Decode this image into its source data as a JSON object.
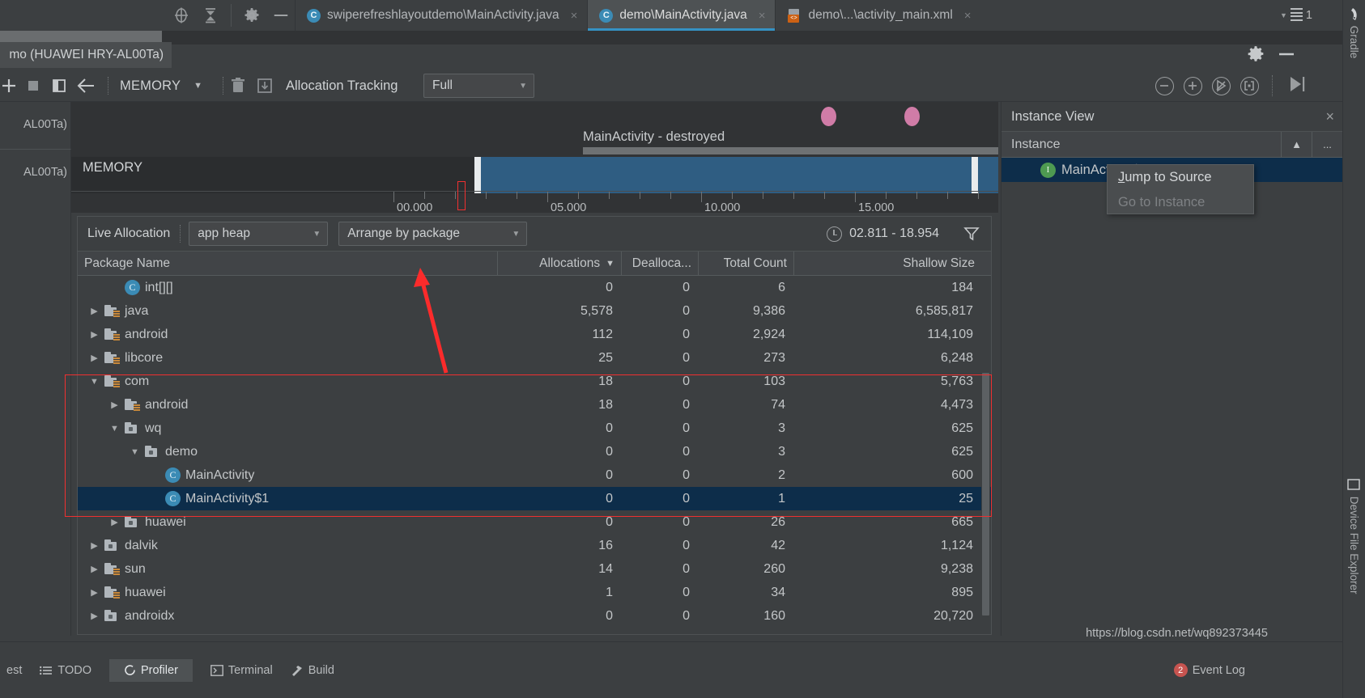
{
  "window": {
    "tabs": [
      {
        "label": "swiperefreshlayoutdemo\\MainActivity.java",
        "icon": "java-class-icon",
        "active": false,
        "close": "×"
      },
      {
        "label": "demo\\MainActivity.java",
        "icon": "java-class-icon",
        "active": true,
        "close": "×"
      },
      {
        "label": "demo\\...\\activity_main.xml",
        "icon": "xml-file-icon",
        "active": false,
        "close": "×"
      }
    ],
    "notification_count": "1"
  },
  "right_strip": {
    "gradle_label": "Gradle",
    "device_file_explorer_label": "Device File Explorer"
  },
  "profiler": {
    "device_label": "mo (HUAWEI HRY-AL00Ta)",
    "left_stub_1": "AL00Ta)",
    "left_stub_2": "AL00Ta)",
    "toolbar": {
      "session_label": "MEMORY",
      "allocation_tracking_label": "Allocation Tracking",
      "allocation_tracking_value": "Full"
    }
  },
  "timeline": {
    "activity_label": "MainActivity - destroyed",
    "memory_label": "MEMORY",
    "ticks": [
      "00.000",
      "05.000",
      "10.000",
      "15.000"
    ]
  },
  "allocation_bar": {
    "title": "Live Allocation",
    "heap_value": "app heap",
    "arrange_value": "Arrange by package",
    "time_range": "02.811 - 18.954"
  },
  "table": {
    "columns": [
      {
        "label": "Package Name",
        "align": "left"
      },
      {
        "label": "Allocations",
        "align": "right",
        "sorted": true,
        "sort_caret": "▼"
      },
      {
        "label": "Dealloca...",
        "align": "right"
      },
      {
        "label": "Total Count",
        "align": "right"
      },
      {
        "label": "Shallow Size",
        "align": "right"
      }
    ],
    "rows": [
      {
        "name": "int[][]",
        "icon": "class-icon",
        "indent": 1,
        "expander": "",
        "allocations": "0",
        "deallocations": "0",
        "total_count": "6",
        "shallow_size": "184",
        "selected": false
      },
      {
        "name": "java",
        "icon": "java-package-icon",
        "indent": 0,
        "expander": "▶",
        "allocations": "5,578",
        "deallocations": "0",
        "total_count": "9,386",
        "shallow_size": "6,585,817",
        "selected": false
      },
      {
        "name": "android",
        "icon": "java-package-icon",
        "indent": 0,
        "expander": "▶",
        "allocations": "112",
        "deallocations": "0",
        "total_count": "2,924",
        "shallow_size": "114,109",
        "selected": false
      },
      {
        "name": "libcore",
        "icon": "java-package-icon",
        "indent": 0,
        "expander": "▶",
        "allocations": "25",
        "deallocations": "0",
        "total_count": "273",
        "shallow_size": "6,248",
        "selected": false
      },
      {
        "name": "com",
        "icon": "java-package-icon",
        "indent": 0,
        "expander": "▼",
        "allocations": "18",
        "deallocations": "0",
        "total_count": "103",
        "shallow_size": "5,763",
        "selected": false
      },
      {
        "name": "android",
        "icon": "java-package-icon",
        "indent": 1,
        "expander": "▶",
        "allocations": "18",
        "deallocations": "0",
        "total_count": "74",
        "shallow_size": "4,473",
        "selected": false
      },
      {
        "name": "wq",
        "icon": "package-icon",
        "indent": 1,
        "expander": "▼",
        "allocations": "0",
        "deallocations": "0",
        "total_count": "3",
        "shallow_size": "625",
        "selected": false
      },
      {
        "name": "demo",
        "icon": "package-icon",
        "indent": 2,
        "expander": "▼",
        "allocations": "0",
        "deallocations": "0",
        "total_count": "3",
        "shallow_size": "625",
        "selected": false
      },
      {
        "name": "MainActivity",
        "icon": "class-icon",
        "indent": 3,
        "expander": "",
        "allocations": "0",
        "deallocations": "0",
        "total_count": "2",
        "shallow_size": "600",
        "selected": false
      },
      {
        "name": "MainActivity$1",
        "icon": "class-icon",
        "indent": 3,
        "expander": "",
        "allocations": "0",
        "deallocations": "0",
        "total_count": "1",
        "shallow_size": "25",
        "selected": true
      },
      {
        "name": "huawei",
        "icon": "package-icon",
        "indent": 1,
        "expander": "▶",
        "allocations": "0",
        "deallocations": "0",
        "total_count": "26",
        "shallow_size": "665",
        "selected": false
      },
      {
        "name": "dalvik",
        "icon": "package-icon",
        "indent": 0,
        "expander": "▶",
        "allocations": "16",
        "deallocations": "0",
        "total_count": "42",
        "shallow_size": "1,124",
        "selected": false
      },
      {
        "name": "sun",
        "icon": "java-package-icon",
        "indent": 0,
        "expander": "▶",
        "allocations": "14",
        "deallocations": "0",
        "total_count": "260",
        "shallow_size": "9,238",
        "selected": false
      },
      {
        "name": "huawei",
        "icon": "java-package-icon",
        "indent": 0,
        "expander": "▶",
        "allocations": "1",
        "deallocations": "0",
        "total_count": "34",
        "shallow_size": "895",
        "selected": false
      },
      {
        "name": "androidx",
        "icon": "package-icon",
        "indent": 0,
        "expander": "▶",
        "allocations": "0",
        "deallocations": "0",
        "total_count": "160",
        "shallow_size": "20,720",
        "selected": false
      }
    ]
  },
  "instance_view": {
    "title": "Instance View",
    "close": "×",
    "column_label": "Instance",
    "sort_button": "▲",
    "more_button": "...",
    "rows": [
      {
        "name": "MainActivity$1",
        "icon": "instance-icon",
        "selected": true
      }
    ]
  },
  "context_menu": {
    "items": [
      {
        "label": "Jump to Source",
        "enabled": true
      },
      {
        "label": "Go to Instance",
        "enabled": false
      }
    ]
  },
  "status_bar": {
    "items": [
      "est",
      "TODO",
      "Profiler",
      "Terminal",
      "Build"
    ],
    "active": "Profiler",
    "event_log": "Event Log",
    "event_count": "2"
  },
  "watermark": "https://blog.csdn.net/wq892373445",
  "colors": {
    "accent": "#3592c4",
    "selection": "#0d2d4a",
    "annotation_red": "#f03030",
    "memory_fill": "#2f5d82",
    "event_dot": "#d07ca7"
  }
}
